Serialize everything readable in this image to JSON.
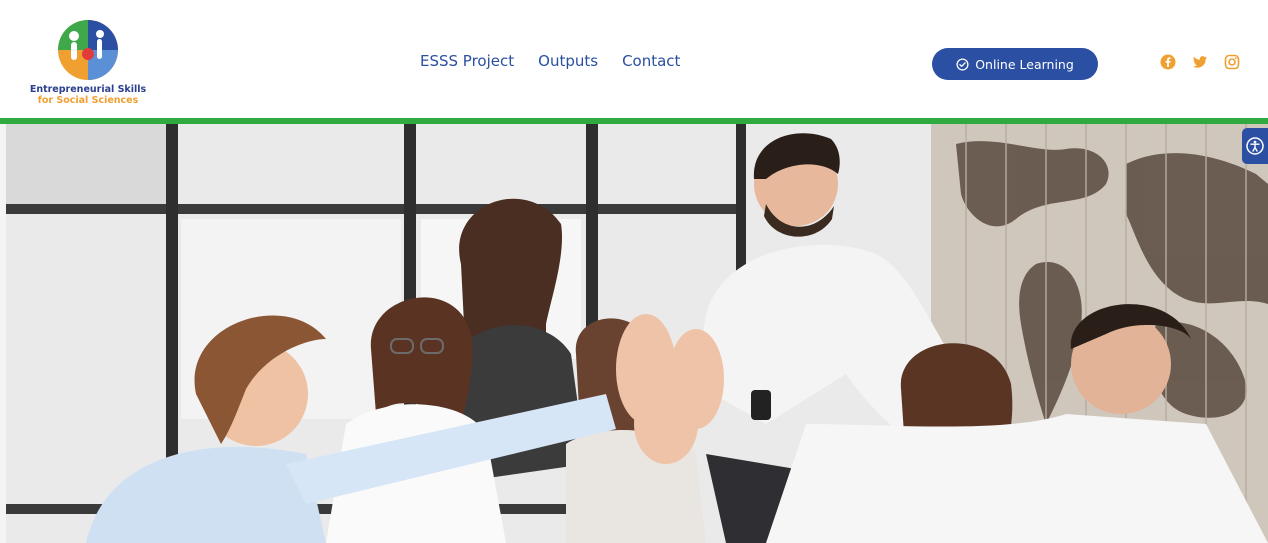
{
  "brand": {
    "line1": "Entrepreneurial Skills",
    "line2": "for Social Sciences"
  },
  "nav": {
    "items": [
      "ESSS Project",
      "Outputs",
      "Contact"
    ]
  },
  "cta": {
    "label": "Online Learning",
    "icon": "circle-check-icon"
  },
  "social": {
    "icons": [
      "facebook-icon",
      "twitter-icon",
      "instagram-icon"
    ]
  },
  "colors": {
    "brand_blue": "#2b4fa3",
    "accent_green": "#2eaa3f",
    "accent_orange": "#f0a030"
  },
  "hero": {
    "description_icon": "team-high-five-photo"
  },
  "accessibility": {
    "icon": "accessibility-icon"
  }
}
